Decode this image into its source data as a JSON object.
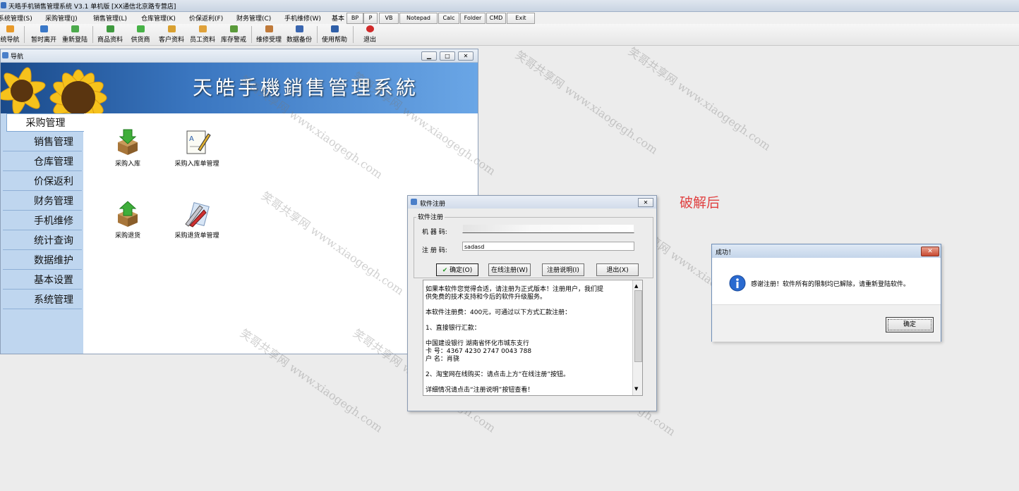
{
  "app": {
    "title": "天皓手机销售管理系统 V3.1 单机版    [XX通信北京路专营店]"
  },
  "menubar": {
    "items": [
      "系统管理(S)",
      "采购管理(J)",
      "销售管理(L)",
      "仓库管理(K)",
      "价保返利(F)",
      "财务管理(C)",
      "手机维修(W)",
      "基本"
    ],
    "quick_buttons": [
      "BP",
      "P",
      "VB",
      "Notepad",
      "Calc",
      "Folder",
      "CMD",
      "Exit"
    ]
  },
  "toolbar": {
    "items": [
      "统导航",
      "暂时离开",
      "重新登陆",
      "商品资料",
      "供货商",
      "客户资料",
      "员工资料",
      "库存警戒",
      "维修受理",
      "数据备份",
      "使用帮助",
      "退出"
    ]
  },
  "nav_window": {
    "title": "导航",
    "banner_title": "天皓手機銷售管理系統",
    "sidebar": [
      "采购管理",
      "销售管理",
      "仓库管理",
      "价保返利",
      "财务管理",
      "手机维修",
      "统计查询",
      "数据维护",
      "基本设置",
      "系统管理"
    ],
    "functions": [
      "采购入库",
      "采购入库单管理",
      "采购退货",
      "采购退货单管理"
    ]
  },
  "reg_dialog": {
    "title": "软件注册",
    "group_label": "软件注册",
    "machine_label": "机 器 码:",
    "machine_value": "",
    "code_label": "注 册 码:",
    "code_value": "sadasd",
    "buttons": [
      "确定(O)",
      "在线注册(W)",
      "注册说明(I)",
      "退出(X)"
    ],
    "text_lines": [
      "      如果本软件您觉得合适，请注册为正式版本！注册用户，我们提",
      "供免费的技术支持和今后的软件升级服务。",
      "",
      "      本软件注册费：400元，可通过以下方式汇款注册：",
      "",
      "1、直接银行汇款：",
      "",
      "中国建设银行 湖南省怀化市城东支行",
      "卡    号：4367 4230 2747 0043 788",
      "户    名：肖骁",
      "",
      "2、淘宝网在线购买：请点击上方“在线注册”按钮。",
      "",
      "详细情况请点击“注册说明”按钮查看！"
    ]
  },
  "success_dialog": {
    "title": "成功！",
    "message": "感谢注册！软件所有的限制均已解除，请重新登陆软件。",
    "ok_label": "确定"
  },
  "annotation": "破解后",
  "watermark": {
    "cn": "笑哥共享网",
    "url": "www.xiaogegh.com"
  },
  "colors": {
    "sidebar_bg": "#bfd6ef",
    "banner_blue": "#2e64ad",
    "annotation_red": "#e04040"
  }
}
